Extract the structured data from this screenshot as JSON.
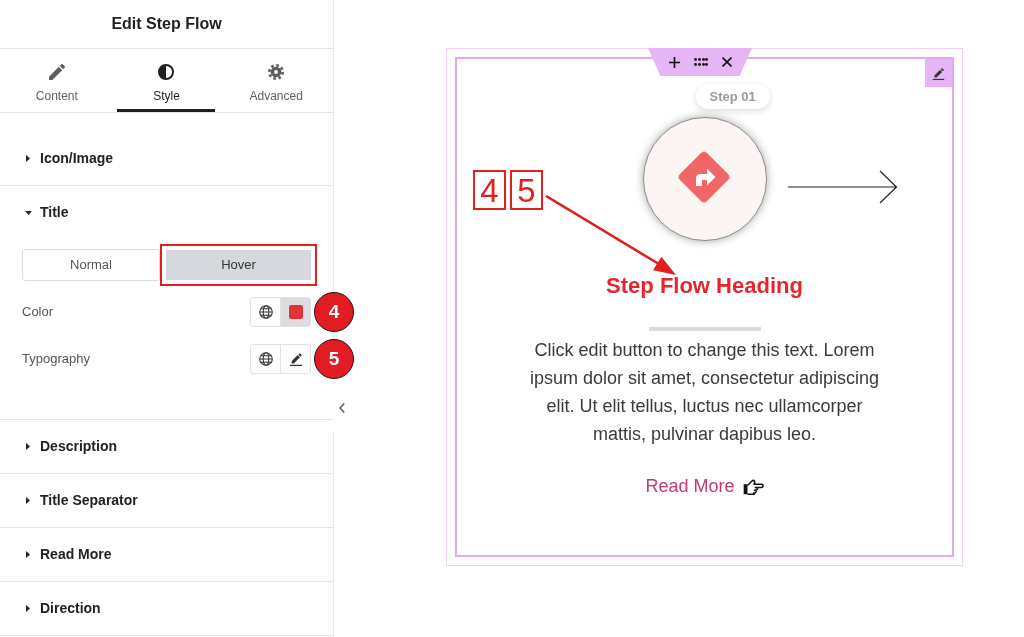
{
  "editor_panel": {
    "title": "Edit Step Flow",
    "tabs": [
      {
        "label": "Content",
        "selected": false
      },
      {
        "label": "Style",
        "selected": true
      },
      {
        "label": "Advanced",
        "selected": false
      }
    ],
    "sections": [
      {
        "label": "Icon/Image",
        "expanded": false
      },
      {
        "label": "Title",
        "expanded": true,
        "state_switch": [
          {
            "label": "Normal",
            "selected": false,
            "highlighted": false
          },
          {
            "label": "Hover",
            "selected": true,
            "highlighted": true
          }
        ],
        "controls": [
          {
            "kind": "color",
            "label": "Color",
            "color": "#e5313a",
            "callout": "4"
          },
          {
            "kind": "typography",
            "label": "Typography",
            "callout": "5"
          }
        ]
      },
      {
        "label": "Description",
        "expanded": false
      },
      {
        "label": "Title Separator",
        "expanded": false
      },
      {
        "label": "Read More",
        "expanded": false
      },
      {
        "label": "Direction",
        "expanded": false
      }
    ]
  },
  "widget": {
    "step_label": "Step 01",
    "title": "Step Flow Heading",
    "description": "Click edit button to change this text. Lorem ipsum dolor sit amet, consectetur adipiscing elit. Ut elit tellus, luctus nec ullamcorper mattis, pulvinar dapibus leo.",
    "read_more": "Read More",
    "annotation_labels": [
      "4",
      "5"
    ]
  }
}
